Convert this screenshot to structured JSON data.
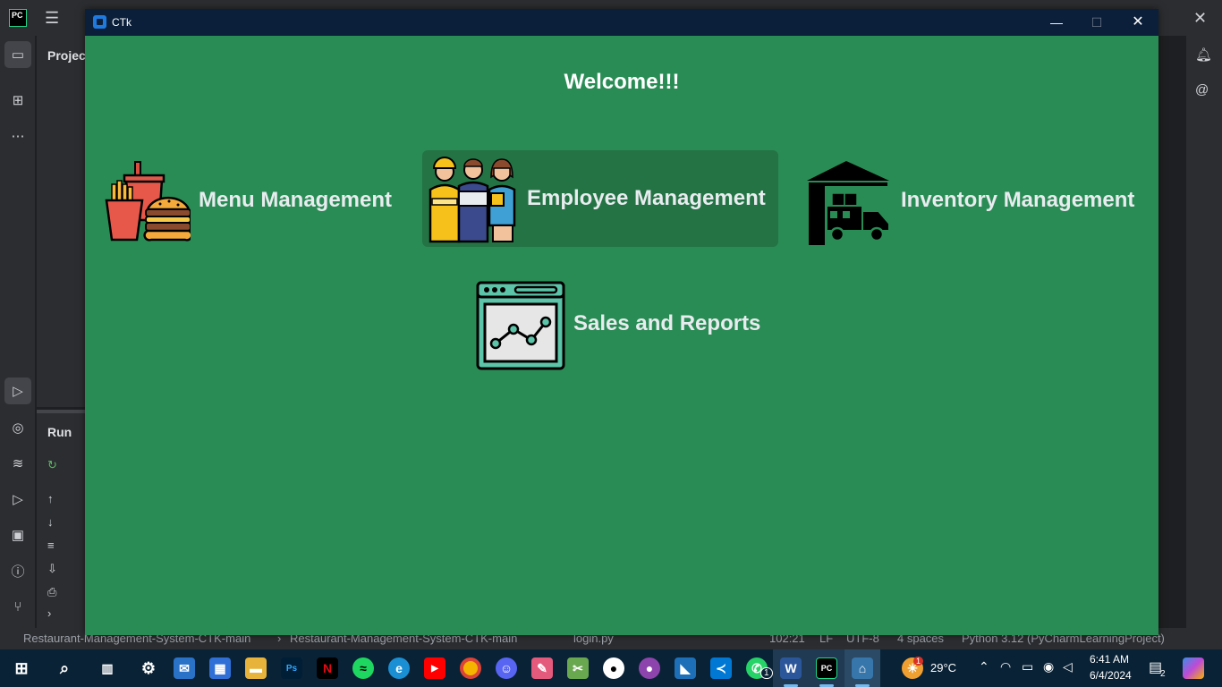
{
  "ide": {
    "logo": "PC",
    "project_label": "Project",
    "run_label": "Run",
    "status": {
      "breadcrumb_1": "Restaurant-Management-System-CTK-main",
      "separator": "›",
      "breadcrumb_2": "Restaurant-Management-System-CTK-main",
      "file": "login.py",
      "position": "102:21",
      "line_ending": "LF",
      "encoding": "UTF-8",
      "indent": "4 spaces",
      "interpreter": "Python 3.12 (PyCharmLearningProject)"
    }
  },
  "window": {
    "title": "CTk",
    "minimize": "—",
    "maximize": "☐",
    "close": "✕"
  },
  "app": {
    "welcome": "Welcome!!!",
    "modules": [
      {
        "label": "Menu Management",
        "icon": "fast-food-icon"
      },
      {
        "label": "Employee Management",
        "icon": "employees-icon"
      },
      {
        "label": "Inventory Management",
        "icon": "warehouse-truck-icon"
      },
      {
        "label": "Sales and Reports",
        "icon": "chart-window-icon"
      }
    ],
    "colors": {
      "background": "#2a8c55",
      "hover": "#237344",
      "text": "#e8ecef"
    }
  },
  "taskbar": {
    "weather_temp": "29°C",
    "weather_badge": "1",
    "time": "6:41 AM",
    "date": "6/4/2024",
    "notification_count": "2",
    "whatsapp_badge": "1"
  }
}
